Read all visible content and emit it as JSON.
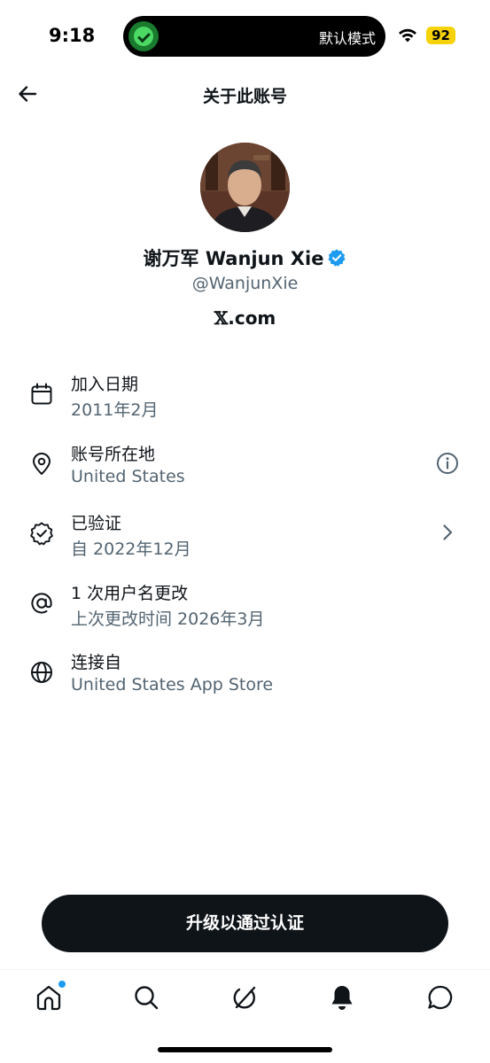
{
  "status_bar": {
    "time": "9:18",
    "island_label": "默认模式",
    "battery": "92",
    "battery_color": "#f5d20a"
  },
  "header": {
    "title": "关于此账号",
    "back_icon": "arrow-left-icon"
  },
  "profile": {
    "name": "谢万军 Wanjun Xie",
    "handle": "@WanjunXie",
    "site_mark": "𝕏",
    "site_suffix": ".com",
    "verified_color": "#1d9bf0"
  },
  "info": {
    "rows": [
      {
        "icon": "calendar-icon",
        "title": "加入日期",
        "subtitle": "2011年2月"
      },
      {
        "icon": "location-pin-icon",
        "title": "账号所在地",
        "subtitle": "United States",
        "trailing": "info-icon"
      },
      {
        "icon": "verified-badge-icon",
        "title": "已验证",
        "subtitle": "自 2022年12月",
        "trailing": "chevron-right-icon"
      },
      {
        "icon": "at-sign-icon",
        "title": "1 次用户名更改",
        "subtitle": "上次更改时间 2026年3月"
      },
      {
        "icon": "globe-icon",
        "title": "连接自",
        "subtitle": "United States App Store"
      }
    ]
  },
  "upgrade_button": {
    "label": "升级以通过认证"
  },
  "tab_bar": {
    "tabs": [
      "home-icon",
      "search-icon",
      "grok-icon",
      "bell-icon",
      "messages-icon"
    ],
    "notification_dot_color": "#1d9bf0"
  }
}
